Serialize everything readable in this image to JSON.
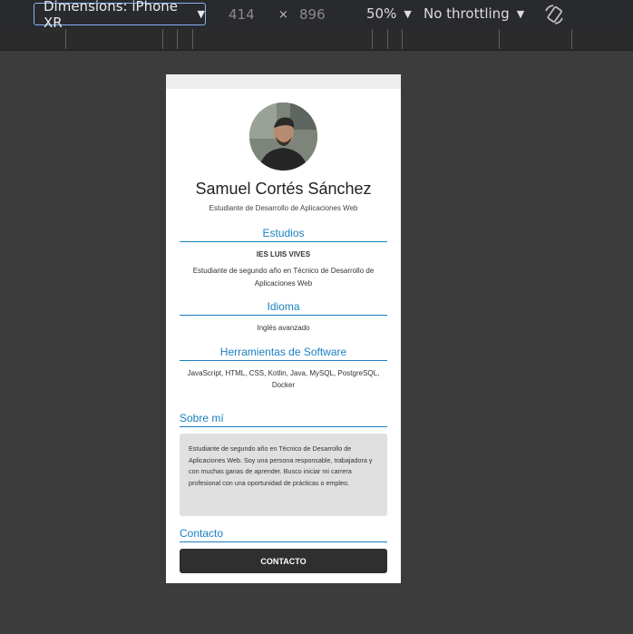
{
  "devtools": {
    "device_label": "Dimensions: iPhone XR",
    "width_value": "414",
    "times_symbol": "×",
    "height_value": "896",
    "zoom_label": "50%",
    "throttling_label": "No throttling",
    "rotate_icon": "rotate-icon"
  },
  "profile": {
    "name": "Samuel Cortés Sánchez",
    "subtitle": "Estudiante de Desarrollo de Aplicaciones Web"
  },
  "sections": {
    "studies": {
      "title": "Estudios",
      "school": "IES LUIS VIVES",
      "desc_line1": "Estudiante de segundo año en Técnico de Desarrollo de",
      "desc_line2": "Aplicaciones Web"
    },
    "language": {
      "title": "Idioma",
      "value": "Inglés avanzado"
    },
    "tools": {
      "title": "Herramientas de Software",
      "line1": "JavaScript, HTML, CSS, Kotlin, Java, MySQL, PostgreSQL,",
      "line2": "Docker"
    },
    "about": {
      "title": "Sobre mí",
      "text": "Estudiante de segundo año en Técnico de Desarrollo de Aplicaciones Web. Soy una persona responsable, trabajadora y con muchas ganas de aprender. Busco iniciar mi carrera profesional con una oportunidad de prácticas o empleo."
    },
    "contact": {
      "title": "Contacto",
      "button_label": "CONTACTO"
    }
  },
  "colors": {
    "accent": "#1a7fc1",
    "button_bg": "#2f2f2f",
    "about_bg": "#e0e0e0"
  }
}
